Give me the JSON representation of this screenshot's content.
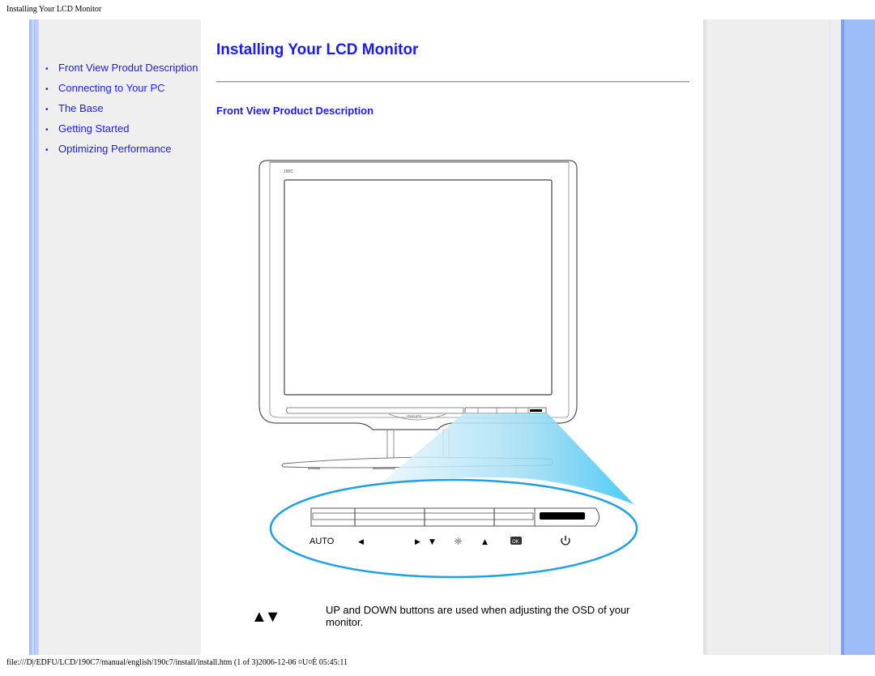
{
  "print_header": "Installing Your LCD Monitor",
  "print_footer": "file:///D|/EDFU/LCD/190C7/manual/english/190c7/install/install.htm (1 of 3)2006-12-06 ¤U¤È 05:45:11",
  "sidebar": {
    "bullet": "•",
    "items": [
      {
        "label": "Front View Produt Description"
      },
      {
        "label": "Connecting to Your PC"
      },
      {
        "label": "The Base"
      },
      {
        "label": "Getting Started"
      },
      {
        "label": "Optimizing Performance"
      }
    ]
  },
  "main": {
    "title": "Installing Your LCD Monitor",
    "section_title": "Front View Product Description",
    "illustration": {
      "model_label": "190C",
      "brand_label": "PHILIPS",
      "button_labels": {
        "auto": "AUTO",
        "left": "◀",
        "right": "▶",
        "down": "▼",
        "brightness": "☼",
        "up": "▲",
        "ok": "OK",
        "power": "⏻"
      }
    },
    "updown_icon": "▲▼",
    "description": "UP and DOWN buttons are used when adjusting the OSD of your monitor."
  },
  "colors": {
    "link": "#1a1aff",
    "side_bar_blue": "#9dbcf8",
    "panel_gray": "#efefef",
    "highlight_blue": "#1ea0e6"
  }
}
